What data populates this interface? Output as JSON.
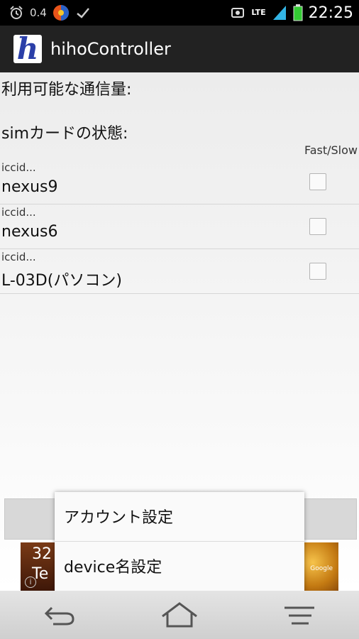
{
  "status_bar": {
    "data_rate": "0.4",
    "network": "LTE",
    "time": "22:25",
    "icons": [
      "alarm-icon",
      "app-icon",
      "check-icon",
      "sync-icon",
      "signal-icon",
      "battery-icon"
    ]
  },
  "app": {
    "logo_letter": "h",
    "title": "hihoController"
  },
  "main": {
    "usage_label": "利用可能な通信量:",
    "sim_status_label": "simカードの状態:",
    "fast_slow_header": "Fast/Slow"
  },
  "sims": [
    {
      "iccid": "iccid...",
      "name": "nexus9",
      "fast": false
    },
    {
      "iccid": "iccid...",
      "name": "nexus6",
      "fast": false
    },
    {
      "iccid": "iccid...",
      "name": "L-03D(パソコン)",
      "fast": false
    }
  ],
  "ad": {
    "text1": "32",
    "text2": "Te",
    "info": "i",
    "brand": "Google"
  },
  "menu": {
    "items": [
      {
        "label": "アカウント設定"
      },
      {
        "label": "device名設定"
      }
    ]
  },
  "navbar": {
    "icons": [
      "back-icon",
      "home-icon",
      "menu-icon"
    ]
  }
}
